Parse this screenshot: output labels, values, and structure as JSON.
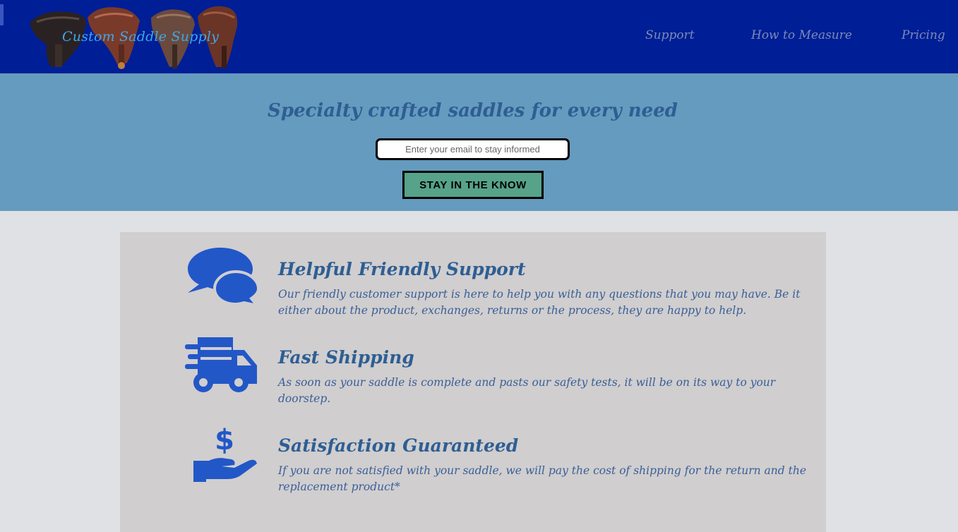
{
  "header": {
    "logo_text": "Custom Saddle Supply",
    "nav": [
      {
        "label": "Support"
      },
      {
        "label": "How to Measure"
      },
      {
        "label": "Pricing"
      }
    ]
  },
  "hero": {
    "title": "Specialty crafted saddles for every need",
    "email_placeholder": "Enter your email to stay informed",
    "button_label": "STAY IN THE KNOW"
  },
  "features": [
    {
      "icon": "chat-bubbles-icon",
      "heading": "Helpful Friendly Support",
      "text": "Our friendly customer support is here to help you with any questions that you may have. Be it either about the product, exchanges, returns or the process, they are happy to help."
    },
    {
      "icon": "delivery-truck-icon",
      "heading": "Fast Shipping",
      "text": "As soon as your saddle is complete and pasts our safety tests, it will be on its way to your doorstep."
    },
    {
      "icon": "hand-dollar-icon",
      "heading": "Satisfaction Guaranteed",
      "text": "If you are not satisfied with your saddle, we will pay the cost of shipping for the return and the replacement product*"
    }
  ],
  "colors": {
    "header_bg": "#001e96",
    "hero_bg": "#659bbe",
    "page_bg": "#dfe1e4",
    "panel_bg": "#d0cecf",
    "icon_blue": "#2257c8",
    "heading_blue": "#2e5e93",
    "button_green": "#57a38a"
  }
}
